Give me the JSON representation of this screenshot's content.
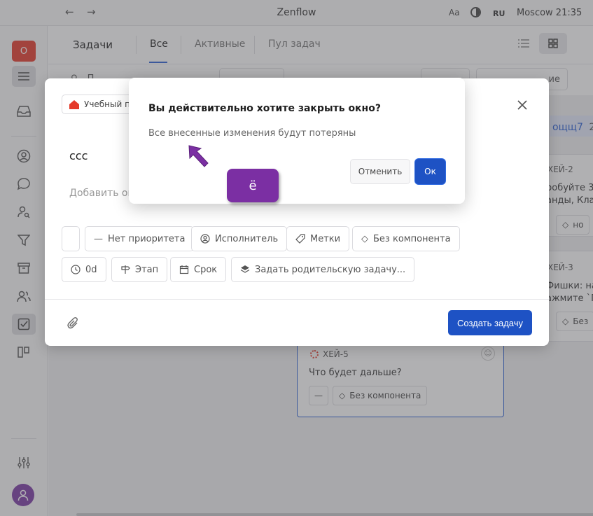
{
  "window": {
    "title": "Zenflow",
    "font_toggle": "Aa",
    "language": "RU",
    "clock": "Moscow  21:35"
  },
  "sidebar": {
    "avatar_letter": "O",
    "accent_color": "#e53a2a",
    "user_color": "#7b3aa5"
  },
  "header": {
    "title": "Задачи",
    "tabs": [
      {
        "label": "Все",
        "active": true
      },
      {
        "label": "Активные",
        "active": false
      },
      {
        "label": "Пул задач",
        "active": false
      }
    ]
  },
  "toolbar": {
    "search_fragment": "П",
    "filter_fragment": "ие"
  },
  "board_bg": {
    "column_label": "ощщ7",
    "column_count": "2",
    "cards": [
      {
        "key": "ХЕЙ-2",
        "text_line1": "робуйте 3",
        "text_line2": "анды, Кла",
        "chip": "но"
      },
      {
        "key": "ХЕЙ-3",
        "text_line1": "Фишки: на",
        "text_line2": "ажмите `П",
        "chip": "Без"
      },
      {
        "key": "ХЕЙ-5",
        "text_line1": "Что будет дальше?",
        "chip_dash": "—",
        "chip": "Без компонента"
      }
    ]
  },
  "task_modal": {
    "project_label": "Учебный п",
    "title": "ссс",
    "description_placeholder": "Добавить оп",
    "chips_row1": {
      "priority": "Нет приоритета",
      "assignee": "Исполнитель",
      "labels": "Метки",
      "component": "Без компонента"
    },
    "chips_row2": {
      "estimate": "0d",
      "stage": "Этап",
      "due": "Срок",
      "parent": "Задать родительскую задачу..."
    },
    "create_label": "Создать задачу",
    "primary_color": "#1e52c4"
  },
  "confirm_dialog": {
    "title": "Вы действительно хотите закрыть окно?",
    "message": "Все внесенные изменения будут потеряны",
    "cancel_label": "Отменить",
    "ok_label": "Ок"
  },
  "annotation": {
    "key_pressed": "ё",
    "badge_color": "#7b2fa3"
  }
}
